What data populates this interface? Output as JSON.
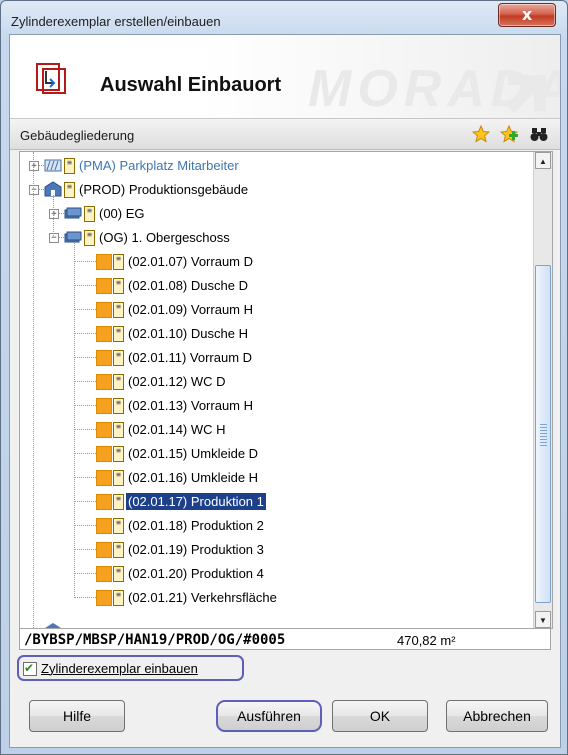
{
  "window": {
    "title": "Zylinderexemplar erstellen/einbauen",
    "close_label": "x"
  },
  "header": {
    "title": "Auswahl Einbauort",
    "watermark": "MORADA"
  },
  "section": {
    "label": "Gebäudegliederung",
    "icons": [
      "favorite-star-icon",
      "add-favorite-icon",
      "binoculars-search-icon"
    ]
  },
  "tree": {
    "items": [
      {
        "label": "(PMA) Parkplatz Mitarbeiter",
        "icon": "parking-icon",
        "expander": "+",
        "level": 0
      },
      {
        "label": "(PROD) Produktionsgebäude",
        "icon": "building-icon",
        "expander": "−",
        "level": 0
      },
      {
        "label": "(00) EG",
        "icon": "floor-icon",
        "expander": "+",
        "level": 1
      },
      {
        "label": "(OG) 1. Obergeschoss",
        "icon": "floor-icon",
        "expander": "−",
        "level": 1
      },
      {
        "label": "(02.01.07) Vorraum D",
        "icon": "room-icon",
        "level": 2
      },
      {
        "label": "(02.01.08) Dusche D",
        "icon": "room-icon",
        "level": 2
      },
      {
        "label": "(02.01.09) Vorraum H",
        "icon": "room-icon",
        "level": 2
      },
      {
        "label": "(02.01.10) Dusche H",
        "icon": "room-icon",
        "level": 2
      },
      {
        "label": "(02.01.11) Vorraum D",
        "icon": "room-icon",
        "level": 2
      },
      {
        "label": "(02.01.12) WC D",
        "icon": "room-icon",
        "level": 2
      },
      {
        "label": "(02.01.13) Vorraum H",
        "icon": "room-icon",
        "level": 2
      },
      {
        "label": "(02.01.14) WC H",
        "icon": "room-icon",
        "level": 2
      },
      {
        "label": "(02.01.15) Umkleide D",
        "icon": "room-icon",
        "level": 2
      },
      {
        "label": "(02.01.16) Umkleide H",
        "icon": "room-icon",
        "level": 2
      },
      {
        "label": "(02.01.17) Produktion 1",
        "icon": "room-icon",
        "level": 2,
        "selected": true
      },
      {
        "label": "(02.01.18) Produktion 2",
        "icon": "room-icon",
        "level": 2
      },
      {
        "label": "(02.01.19) Produktion 3",
        "icon": "room-icon",
        "level": 2
      },
      {
        "label": "(02.01.20) Produktion 4",
        "icon": "room-icon",
        "level": 2
      },
      {
        "label": "(02.01.21) Verkehrsfläche",
        "icon": "room-icon",
        "level": 2
      }
    ]
  },
  "path": {
    "value": "/BYBSP/MBSP/HAN19/PROD/OG/#0005",
    "area": "470,82 m²"
  },
  "checkbox": {
    "label": "Zylinderexemplar einbauen",
    "checked": true
  },
  "buttons": {
    "help": "Hilfe",
    "execute": "Ausführen",
    "ok": "OK",
    "cancel": "Abbrechen"
  },
  "colors": {
    "selection": "#1e3f8a",
    "room_icon": "#f5a11f",
    "focus_ring": "#5d5fb8"
  }
}
